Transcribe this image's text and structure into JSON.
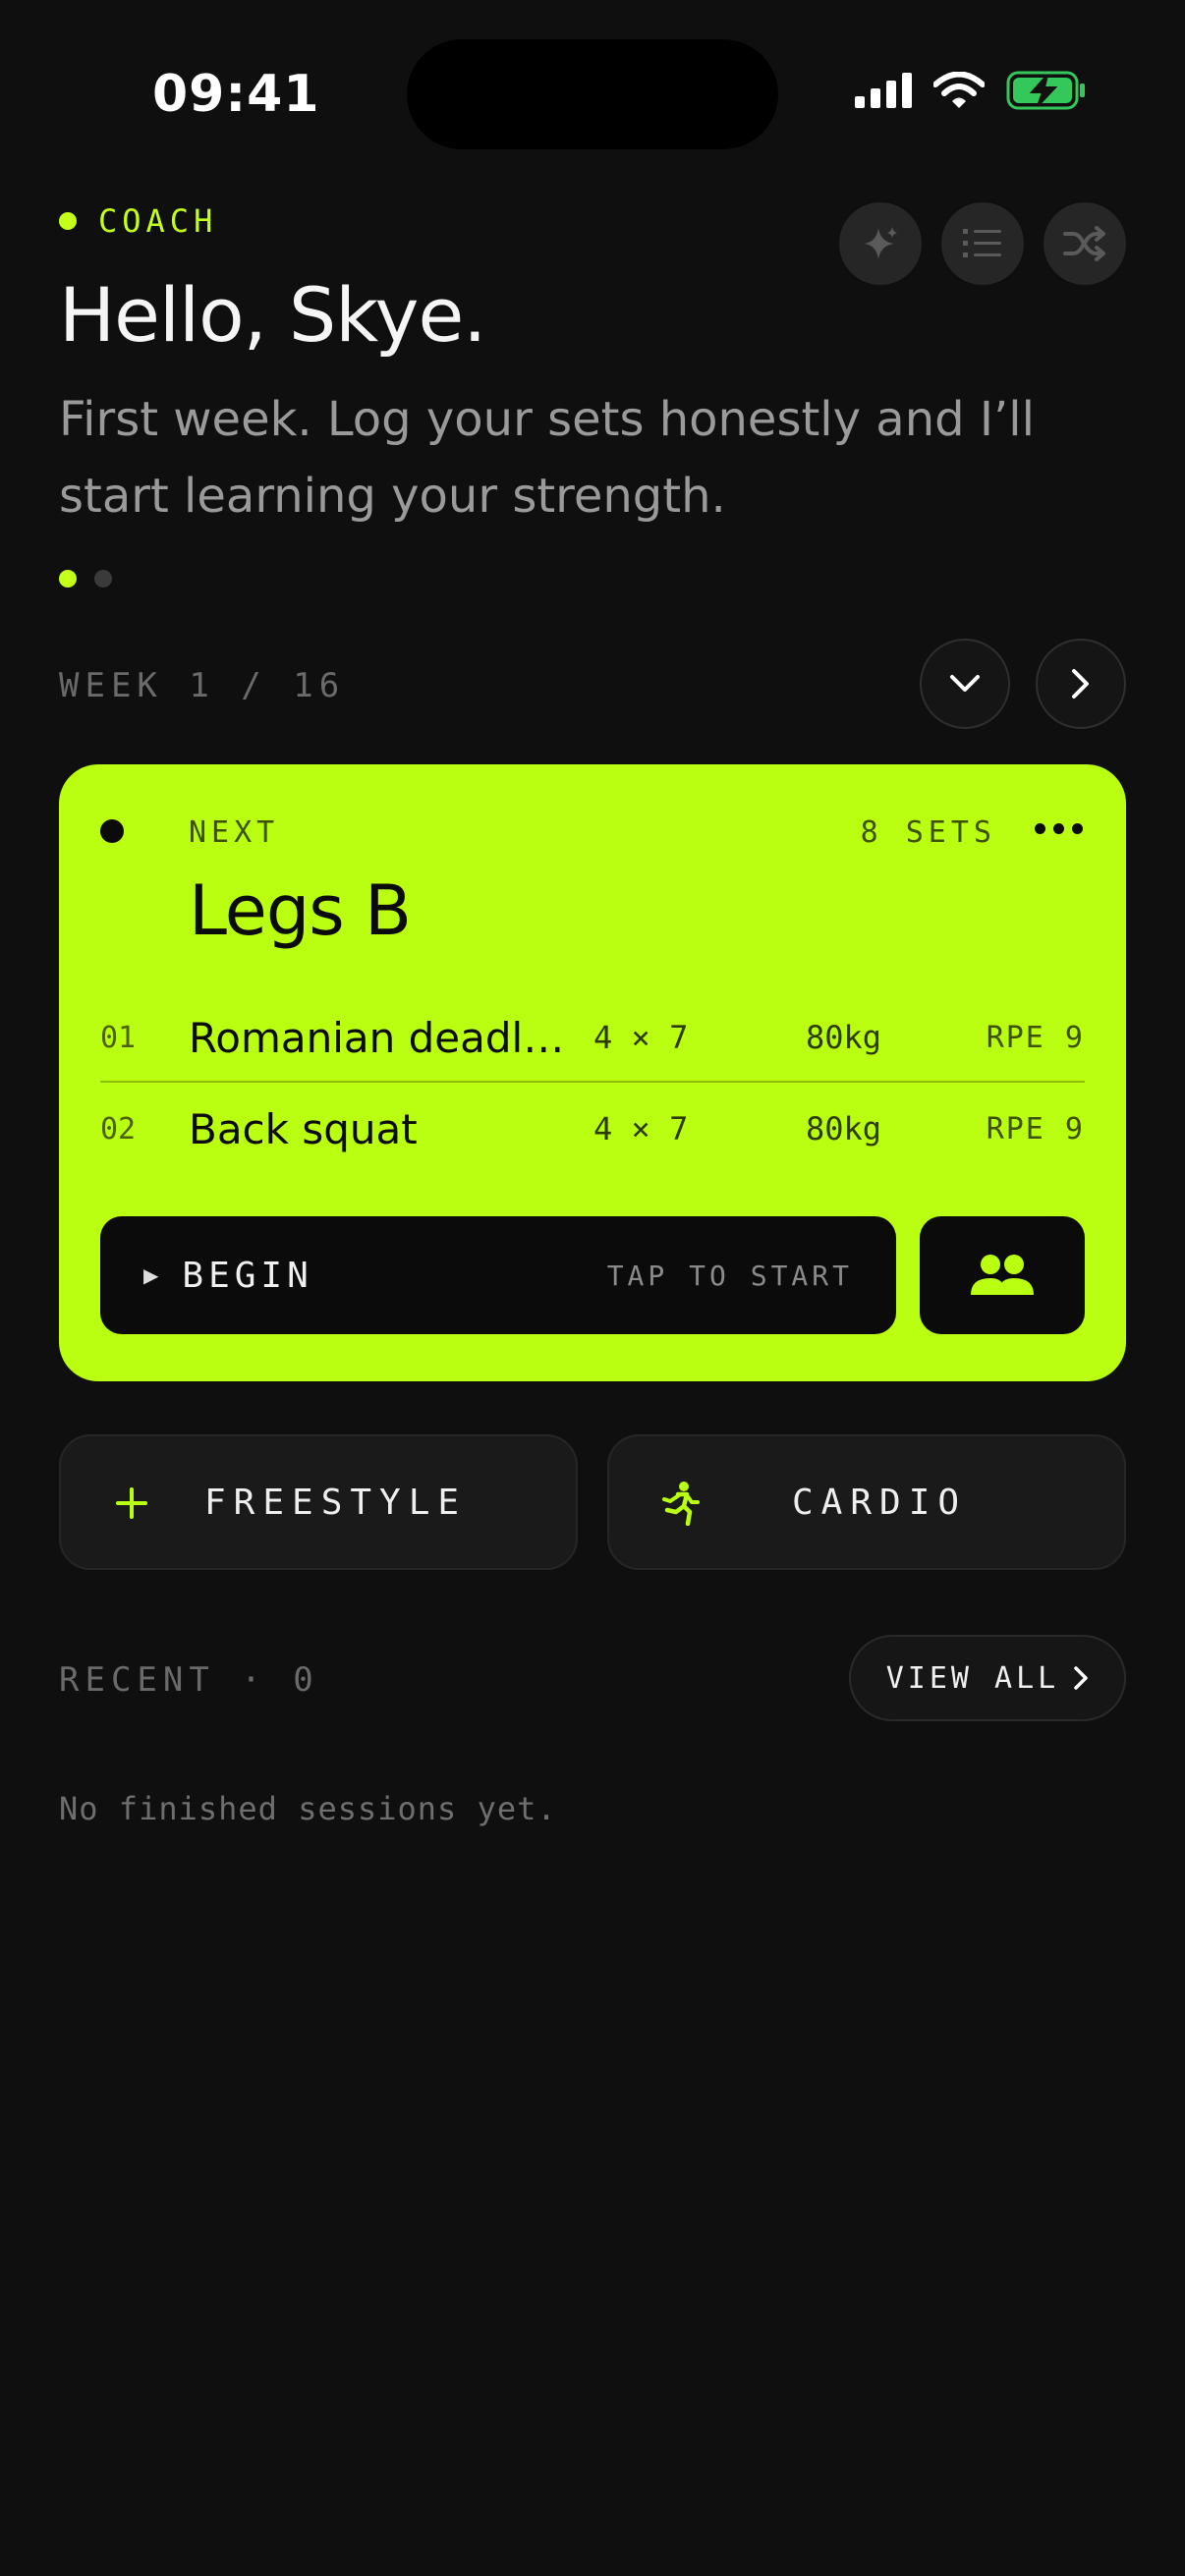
{
  "status_bar": {
    "time": "09:41"
  },
  "coach": {
    "label": "COACH",
    "greeting": "Hello, Skye.",
    "message": "First week. Log your sets honestly and I’ll start learning your strength.",
    "pager": {
      "count": 2,
      "active_index": 0
    }
  },
  "header_buttons": [
    {
      "icon": "sparkle-icon"
    },
    {
      "icon": "list-icon"
    },
    {
      "icon": "shuffle-icon"
    }
  ],
  "week": {
    "label": "WEEK 1 / 16"
  },
  "next_workout": {
    "tag": "NEXT",
    "sets": "8 SETS",
    "title": "Legs B",
    "exercises": [
      {
        "num": "01",
        "name": "Romanian deadl…",
        "scheme": "4 × 7",
        "weight": "80kg",
        "rpe": "RPE 9"
      },
      {
        "num": "02",
        "name": "Back squat",
        "scheme": "4 × 7",
        "weight": "80kg",
        "rpe": "RPE 9"
      }
    ],
    "begin_label": "BEGIN",
    "begin_hint": "TAP TO START"
  },
  "modes": {
    "freestyle": "FREESTYLE",
    "cardio": "CARDIO"
  },
  "recent": {
    "label": "RECENT · 0",
    "view_all": "VIEW ALL",
    "empty": "No finished sessions yet."
  },
  "colors": {
    "accent": "#baff12",
    "background": "#0f0f0f",
    "battery": "#34c759"
  }
}
